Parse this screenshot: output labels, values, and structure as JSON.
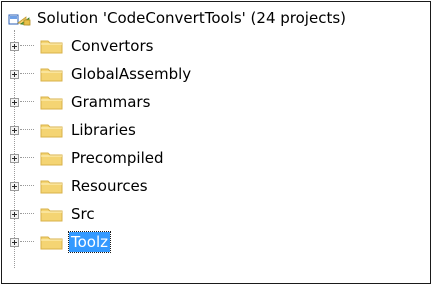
{
  "solution": {
    "label": "Solution 'CodeConvertTools' (24 projects)",
    "icon": "solution-icon"
  },
  "folders": [
    {
      "label": "Convertors",
      "icon": "folder-icon",
      "expander": "plus",
      "selected": false
    },
    {
      "label": "GlobalAssembly",
      "icon": "folder-icon",
      "expander": "plus",
      "selected": false
    },
    {
      "label": "Grammars",
      "icon": "folder-icon",
      "expander": "plus",
      "selected": false
    },
    {
      "label": "Libraries",
      "icon": "folder-icon",
      "expander": "plus",
      "selected": false
    },
    {
      "label": "Precompiled",
      "icon": "folder-icon",
      "expander": "plus",
      "selected": false
    },
    {
      "label": "Resources",
      "icon": "folder-icon",
      "expander": "plus",
      "selected": false
    },
    {
      "label": "Src",
      "icon": "folder-icon",
      "expander": "plus",
      "selected": false
    },
    {
      "label": "Toolz",
      "icon": "folder-icon",
      "expander": "plus",
      "selected": true
    }
  ],
  "colors": {
    "selection": "#3399ff",
    "folder": "#f4d473",
    "folder_dark": "#d8b24a",
    "tree_lines": "#9a9a9a"
  }
}
